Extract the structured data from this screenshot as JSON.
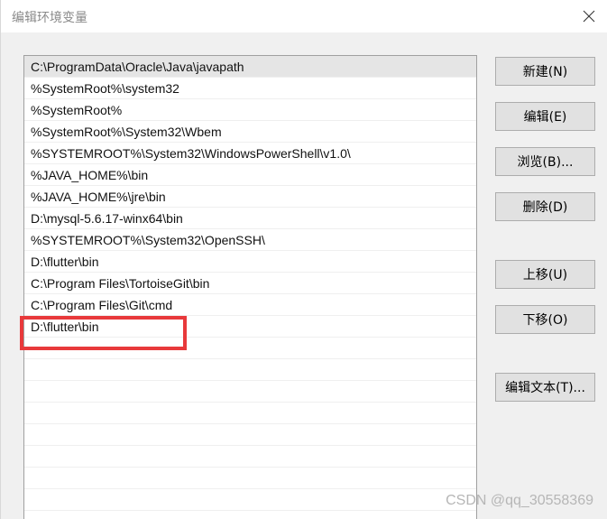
{
  "window": {
    "title": "编辑环境变量"
  },
  "path_list": [
    "C:\\ProgramData\\Oracle\\Java\\javapath",
    "%SystemRoot%\\system32",
    "%SystemRoot%",
    "%SystemRoot%\\System32\\Wbem",
    "%SYSTEMROOT%\\System32\\WindowsPowerShell\\v1.0\\",
    "%JAVA_HOME%\\bin",
    "%JAVA_HOME%\\jre\\bin",
    "D:\\mysql-5.6.17-winx64\\bin",
    "%SYSTEMROOT%\\System32\\OpenSSH\\",
    "D:\\flutter\\bin",
    "C:\\Program Files\\TortoiseGit\\bin",
    "C:\\Program Files\\Git\\cmd",
    "D:\\flutter\\bin"
  ],
  "buttons": {
    "new": "新建(N)",
    "edit": "编辑(E)",
    "browse": "浏览(B)...",
    "delete": "删除(D)",
    "move_up": "上移(U)",
    "move_down": "下移(O)",
    "edit_text": "编辑文本(T)..."
  },
  "watermark": "CSDN @qq_30558369",
  "colors": {
    "highlight": "#e8393b",
    "selected_row": "#e5e5e5"
  }
}
